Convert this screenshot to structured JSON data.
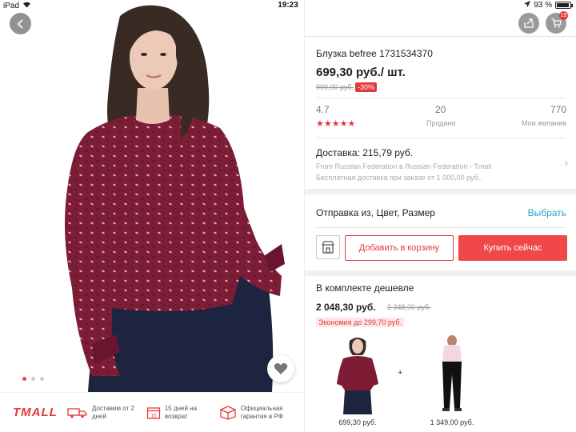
{
  "status_bar": {
    "device": "iPad",
    "time": "19:23",
    "battery_text": "93 %",
    "battery_level": 0.93
  },
  "gallery": {
    "image_count": 3,
    "active_index": 0
  },
  "footer": {
    "brand": "TMALL",
    "features": [
      {
        "icon": "truck-icon",
        "text": "Доставим от 2 дней"
      },
      {
        "icon": "calendar-icon",
        "text": "15 дней на возврат"
      },
      {
        "icon": "box-icon",
        "text": "Официальная гарантия в РФ"
      }
    ],
    "calendar_number": "15"
  },
  "header_actions": {
    "cart_count": "19"
  },
  "product": {
    "title": "Блузка befree 1731534370",
    "price": "699,30 руб./ шт.",
    "old_price": "999,00 руб.",
    "discount": "-30%"
  },
  "stats": {
    "rating": "4.7",
    "stars": "★★★★★",
    "sold_count": "20",
    "sold_label": "Продано",
    "wishlist_count": "770",
    "wishlist_label": "Мои желания"
  },
  "delivery": {
    "title": "Доставка: 215,79 руб.",
    "from": "From Russian Federation в Russian Federation - Tmall",
    "free_note": "Бесплатная доставка при заказе от 1 000,00 руб.."
  },
  "options": {
    "label": "Отправка из, Цвет, Размер",
    "select_link": "Выбрать"
  },
  "actions": {
    "add_to_cart": "Добавить в корзину",
    "buy_now": "Купить сейчас"
  },
  "bundle": {
    "title": "В комплекте дешевле",
    "price": "2 048,30 руб.",
    "old_price": "2 348,00 руб.",
    "savings": "Экономия до 299,70 руб.",
    "items": [
      {
        "name": "blouse",
        "price": "699,30 руб."
      },
      {
        "name": "jeans",
        "price": "1 349,00 руб."
      }
    ],
    "plus": "+"
  },
  "colors": {
    "accent_red": "#e4393c",
    "link_blue": "#2ba4c8",
    "blouse": "#7e1c36",
    "skirt": "#1c2440"
  }
}
